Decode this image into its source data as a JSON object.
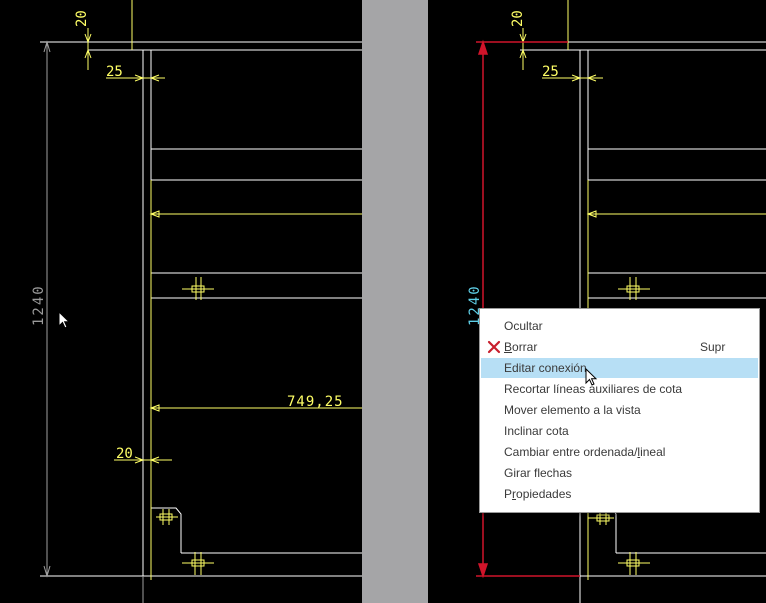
{
  "left_view": {
    "dimensions": {
      "top_vertical": "20",
      "top_horizontal": "25",
      "overall_height": "1240",
      "lower_horizontal": "749,25",
      "bottom_horizontal": "20"
    }
  },
  "right_view": {
    "dimensions": {
      "top_vertical": "20",
      "top_horizontal": "25",
      "overall_height": "1240"
    },
    "selected_dimension_color": "#d0142a"
  },
  "colors": {
    "background": "#000000",
    "geometry": "#ffffff",
    "dimension": "#ffff66",
    "selected_dimension_text": "#5fd0e8",
    "divider": "#a5a5a7",
    "menu_highlight": "#b7dff5"
  },
  "context_menu": {
    "items": [
      {
        "label": "Ocultar",
        "shortcut": "",
        "icon": ""
      },
      {
        "label": "Borrar",
        "shortcut": "Supr",
        "icon": "delete-x-icon"
      },
      {
        "label": "Editar conexión",
        "shortcut": "",
        "icon": "",
        "highlighted": true
      },
      {
        "label": "Recortar líneas auxiliares de cota",
        "shortcut": "",
        "icon": ""
      },
      {
        "label": "Mover elemento a la vista",
        "shortcut": "",
        "icon": ""
      },
      {
        "label": "Inclinar cota",
        "shortcut": "",
        "icon": ""
      },
      {
        "label": "Cambiar entre ordenada/lineal",
        "shortcut": "",
        "icon": ""
      },
      {
        "label": "Girar flechas",
        "shortcut": "",
        "icon": ""
      },
      {
        "label": "Propiedades",
        "shortcut": "",
        "icon": ""
      }
    ]
  }
}
